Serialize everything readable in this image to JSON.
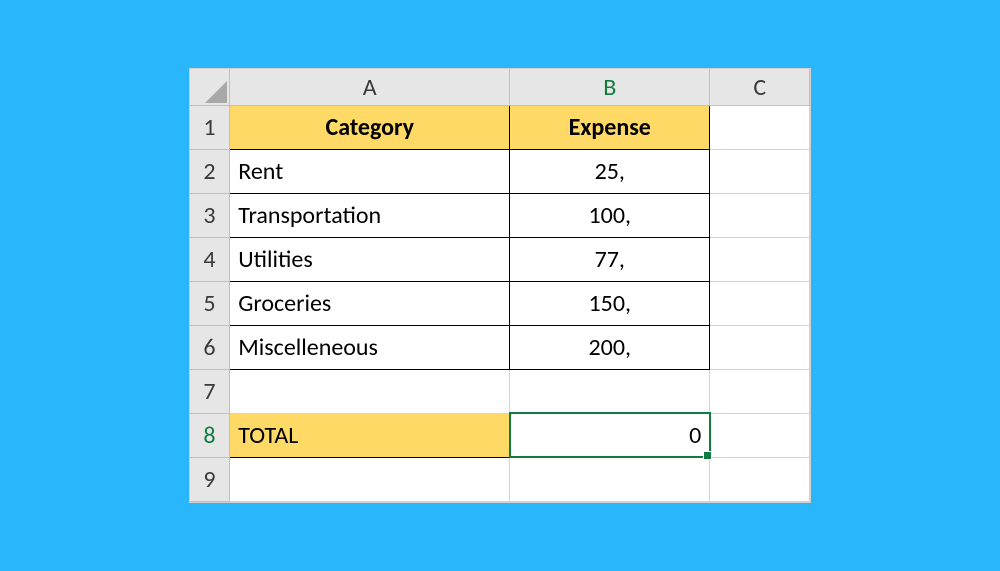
{
  "columns": {
    "A": "A",
    "B": "B",
    "C": "C"
  },
  "rows": {
    "r1": "1",
    "r2": "2",
    "r3": "3",
    "r4": "4",
    "r5": "5",
    "r6": "6",
    "r7": "7",
    "r8": "8",
    "r9": "9"
  },
  "header": {
    "category": "Category",
    "expense": "Expense"
  },
  "data": [
    {
      "category": "Rent",
      "expense": "25,"
    },
    {
      "category": "Transportation",
      "expense": "100,"
    },
    {
      "category": "Utilities",
      "expense": "77,"
    },
    {
      "category": "Groceries",
      "expense": "150,"
    },
    {
      "category": "Miscelleneous",
      "expense": "200,"
    }
  ],
  "total": {
    "label": "TOTAL",
    "value": "0"
  },
  "selected_cell": "B8",
  "colors": {
    "highlight": "#ffd966",
    "selection": "#107c41",
    "page_bg": "#29b6fb"
  },
  "chart_data": {
    "type": "table",
    "columns": [
      "Category",
      "Expense"
    ],
    "rows": [
      [
        "Rent",
        "25,"
      ],
      [
        "Transportation",
        "100,"
      ],
      [
        "Utilities",
        "77,"
      ],
      [
        "Groceries",
        "150,"
      ],
      [
        "Miscelleneous",
        "200,"
      ]
    ],
    "total": [
      "TOTAL",
      "0"
    ]
  }
}
